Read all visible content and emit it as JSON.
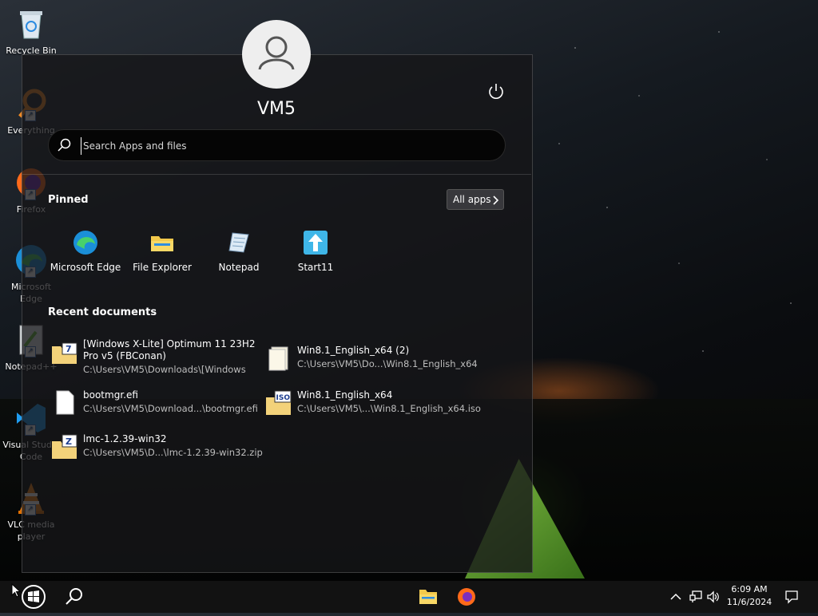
{
  "desktop": {
    "icons": [
      {
        "label": "Recycle Bin"
      },
      {
        "label": "Everything"
      },
      {
        "label": "Firefox"
      },
      {
        "label": "Microsoft Edge"
      },
      {
        "label": "Notepad++"
      },
      {
        "label": "Visual Studio Code"
      },
      {
        "label": "VLC media player"
      }
    ]
  },
  "start_menu": {
    "user_name": "VM5",
    "search_placeholder": "Search Apps and files",
    "pinned_title": "Pinned",
    "all_apps_label": "All apps",
    "pinned": [
      {
        "label": "Microsoft Edge",
        "icon": "edge-icon"
      },
      {
        "label": "File Explorer",
        "icon": "folder-icon"
      },
      {
        "label": "Notepad",
        "icon": "notepad-icon"
      },
      {
        "label": "Start11",
        "icon": "start11-icon"
      }
    ],
    "recent_title": "Recent documents",
    "recent": [
      {
        "name": "[Windows X-Lite] Optimum 11 23H2 Pro v5 (FBConan)",
        "path": "C:\\Users\\VM5\\Downloads\\[Windows",
        "icon": "7zip-archive-icon"
      },
      {
        "name": "Win8.1_English_x64 (2)",
        "path": "C:\\Users\\VM5\\Do...\\Win8.1_English_x64",
        "icon": "file-icon"
      },
      {
        "name": "bootmgr.efi",
        "path": "C:\\Users\\VM5\\Download...\\bootmgr.efi",
        "icon": "blank-file-icon"
      },
      {
        "name": "Win8.1_English_x64",
        "path": "C:\\Users\\VM5\\...\\Win8.1_English_x64.iso",
        "icon": "iso-archive-icon"
      },
      {
        "name": "lmc-1.2.39-win32",
        "path": "C:\\Users\\VM5\\D...\\lmc-1.2.39-win32.zip",
        "icon": "zip-archive-icon"
      }
    ]
  },
  "taskbar": {
    "time": "6:09 AM",
    "date": "11/6/2024"
  },
  "colors": {
    "accent_blue": "#1e90ff",
    "folder_yellow": "#f3c94b"
  }
}
